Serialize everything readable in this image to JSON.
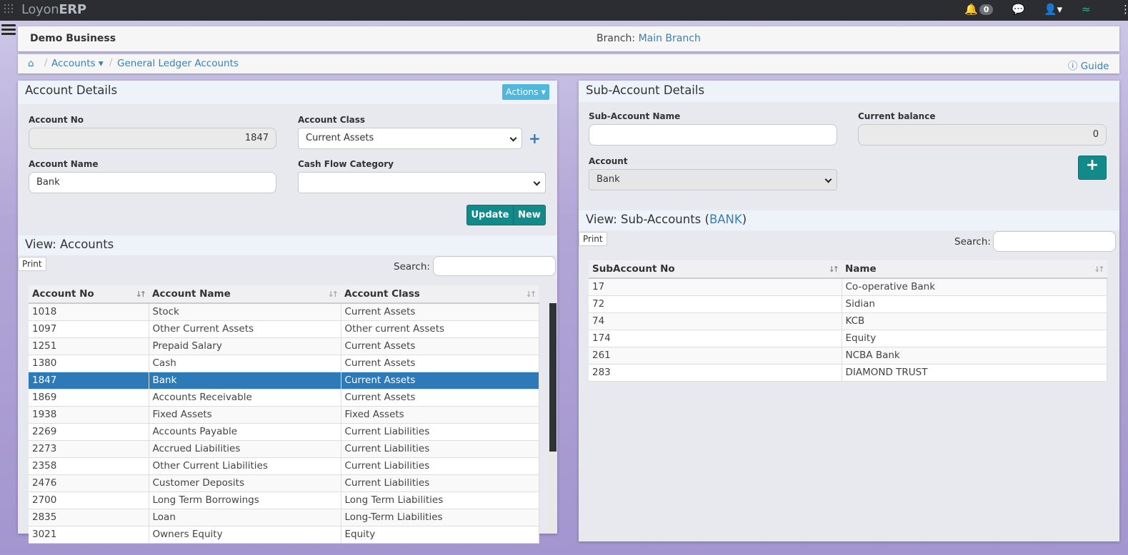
{
  "app": {
    "brand_light": "Loyon",
    "brand_bold": "ERP",
    "notification_count": "0"
  },
  "company": {
    "name": "Demo Business",
    "branch_label": "Branch:",
    "branch_value": "Main Branch"
  },
  "breadcrumb": {
    "accounts": "Accounts",
    "ledger": "General Ledger Accounts",
    "guide": "Guide"
  },
  "account_details": {
    "title": "Account Details",
    "actions_label": "Actions",
    "account_no_label": "Account No",
    "account_no_value": "1847",
    "account_class_label": "Account Class",
    "account_class_value": "Current Assets",
    "account_name_label": "Account Name",
    "account_name_value": "Bank",
    "cash_flow_label": "Cash Flow Category",
    "cash_flow_value": "",
    "update_label": "Update",
    "new_label": "New"
  },
  "accounts_view": {
    "title": "View: Accounts",
    "print_label": "Print",
    "search_label": "Search:",
    "columns": [
      "Account No",
      "Account Name",
      "Account Class"
    ],
    "rows": [
      [
        "1018",
        "Stock",
        "Current Assets"
      ],
      [
        "1097",
        "Other Current Assets",
        "Other current Assets"
      ],
      [
        "1251",
        "Prepaid Salary",
        "Current Assets"
      ],
      [
        "1380",
        "Cash",
        "Current Assets"
      ],
      [
        "1847",
        "Bank",
        "Current Assets"
      ],
      [
        "1869",
        "Accounts Receivable",
        "Current Assets"
      ],
      [
        "1938",
        "Fixed Assets",
        "Fixed Assets"
      ],
      [
        "2269",
        "Accounts Payable",
        "Current Liabilities"
      ],
      [
        "2273",
        "Accrued Liabilities",
        "Current Liabilities"
      ],
      [
        "2358",
        "Other Current Liabilities",
        "Current Liabilities"
      ],
      [
        "2476",
        "Customer Deposits",
        "Current Liabilities"
      ],
      [
        "2700",
        "Long Term Borrowings",
        "Long Term Liabilities"
      ],
      [
        "2835",
        "Loan",
        "Long-Term Liabilities"
      ],
      [
        "3021",
        "Owners Equity",
        "Equity"
      ]
    ],
    "selected_row": 4
  },
  "sub_account_details": {
    "title": "Sub-Account Details",
    "name_label": "Sub-Account Name",
    "name_value": "",
    "balance_label": "Current balance",
    "balance_value": "0",
    "account_label": "Account",
    "account_value": "Bank",
    "add_label": "+"
  },
  "sub_accounts_view": {
    "title_prefix": "View: Sub-Accounts (",
    "title_account": "BANK",
    "title_suffix": ")",
    "print_label": "Print",
    "search_label": "Search:",
    "columns": [
      "SubAccount No",
      "Name"
    ],
    "rows": [
      [
        "17",
        "Co-operative Bank"
      ],
      [
        "72",
        "Sidian"
      ],
      [
        "74",
        "KCB"
      ],
      [
        "174",
        "Equity"
      ],
      [
        "261",
        "NCBA Bank"
      ],
      [
        "283",
        "DIAMOND TRUST"
      ]
    ]
  },
  "colors": {
    "accent": "#2e7ab8",
    "teal": "#128a8a",
    "link": "#3a7fb4",
    "topbar": "#2b2d30"
  }
}
